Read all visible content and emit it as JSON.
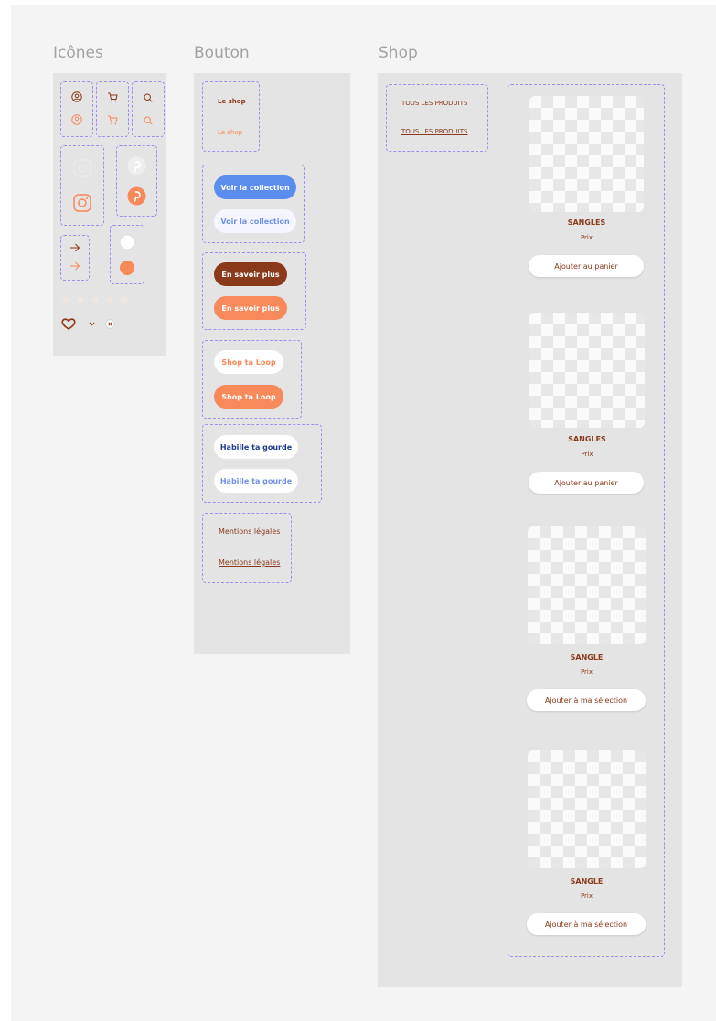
{
  "sections": {
    "icons": "Icônes",
    "buttons": "Bouton",
    "shop": "Shop"
  },
  "buttons": {
    "le_shop_1": "Le shop",
    "le_shop_2": "Le shop",
    "voir_collection_1": "Voir la collection",
    "voir_collection_2": "Voir la collection",
    "en_savoir_1": "En savoir plus",
    "en_savoir_2": "En savoir plus",
    "shop_loop_1": "Shop ta Loop",
    "shop_loop_2": "Shop ta Loop",
    "habille_1": "Habille ta gourde",
    "habille_2": "Habille ta gourde",
    "mentions_1": "Mentions légales",
    "mentions_2": "Mentions légales"
  },
  "shop": {
    "filters": [
      "TOUS LES PRODUITS",
      "TOUS LES PRODUITS"
    ],
    "products": [
      {
        "name": "SANGLES",
        "price": "Prix",
        "cta": "Ajouter au panier"
      },
      {
        "name": "SANGLES",
        "price": "Prix",
        "cta": "Ajouter au panier"
      },
      {
        "name": "SANGLE",
        "price": "Prix",
        "cta": "Ajouter à ma sélection"
      },
      {
        "name": "SANGLE",
        "price": "Prix",
        "cta": "Ajouter à ma sélection"
      }
    ]
  },
  "colors": {
    "brown": "#8a3a1a",
    "orange": "#f7895a",
    "blue": "#5b8def",
    "navy": "#1f3b8f",
    "dash": "#a78bf0"
  },
  "icon_names": [
    "user-icon",
    "cart-icon",
    "search-icon",
    "instagram-icon",
    "pinterest-icon",
    "arrow-right-icon",
    "radio-icon",
    "star-icon",
    "heart-icon",
    "chevron-down-icon",
    "close-icon"
  ]
}
